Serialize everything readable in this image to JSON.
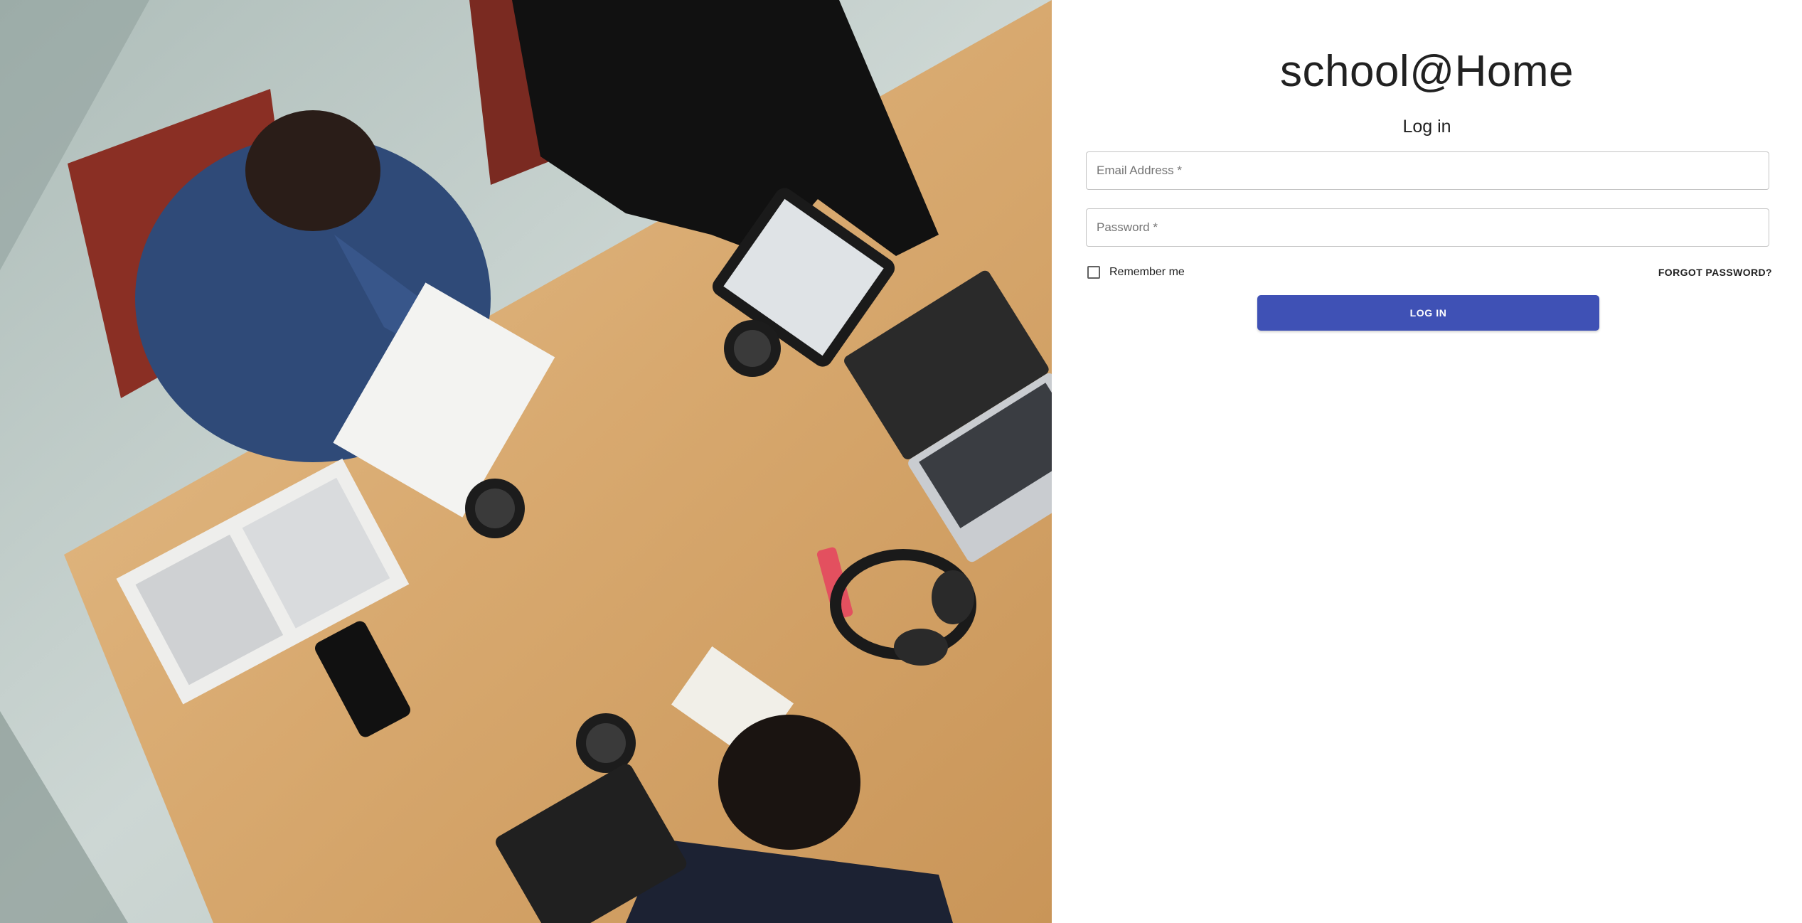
{
  "brand": {
    "title": "school@Home"
  },
  "form": {
    "heading": "Log in",
    "email": {
      "value": "",
      "placeholder": "Email Address *"
    },
    "password": {
      "value": "",
      "placeholder": "Password *"
    },
    "remember_label": "Remember me",
    "remember_checked": false,
    "forgot_label": "FORGOT PASSWORD?",
    "submit_label": "LOG IN"
  },
  "colors": {
    "primary": "#3f51b5",
    "table": "#d9ad77",
    "background": "#ffffff"
  }
}
